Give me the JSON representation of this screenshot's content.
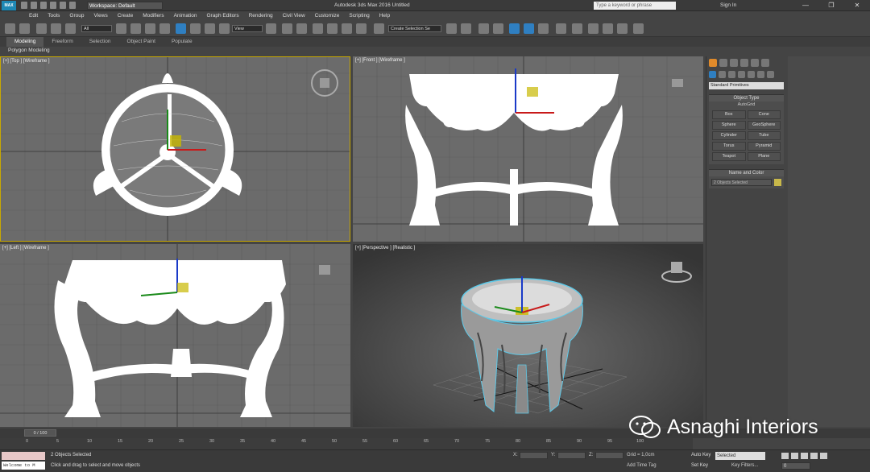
{
  "app": {
    "title": "Autodesk 3ds Max 2016     Untitled",
    "logo": "MAX",
    "workspace": "Workspace: Default",
    "search_placeholder": "Type a keyword or phrase",
    "signin": "Sign In"
  },
  "menu": [
    "Edit",
    "Tools",
    "Group",
    "Views",
    "Create",
    "Modifiers",
    "Animation",
    "Graph Editors",
    "Rendering",
    "Civil View",
    "Customize",
    "Scripting",
    "Help"
  ],
  "toolbar": {
    "filter": "All",
    "ref_coord": "View",
    "selection_set": "Create Selection Se"
  },
  "ribbon": {
    "tabs": [
      "Modeling",
      "Freeform",
      "Selection",
      "Object Paint",
      "Populate"
    ],
    "active_tab": "Modeling",
    "sub": "Polygon Modeling"
  },
  "viewports": {
    "top": "[+] [Top ] [Wireframe ]",
    "front": "[+] [Front ] [Wireframe ]",
    "left": "[+] [Left ] [Wireframe ]",
    "perspective": "[+] [Perspective ] [Realistic ]"
  },
  "command_panel": {
    "dropdown": "Standard Primitives",
    "object_type_title": "Object Type",
    "autogrid": "AutoGrid",
    "buttons": [
      "Box",
      "Cone",
      "Sphere",
      "GeoSphere",
      "Cylinder",
      "Tube",
      "Torus",
      "Pyramid",
      "Teapot",
      "Plane"
    ],
    "name_color_title": "Name and Color",
    "name_value": "2 Objects Selected",
    "swatch_color": "#c8b84a"
  },
  "timeline": {
    "slider": "0 / 100",
    "ticks": [
      "0",
      "5",
      "10",
      "15",
      "20",
      "25",
      "30",
      "35",
      "40",
      "45",
      "50",
      "55",
      "60",
      "65",
      "70",
      "75",
      "80",
      "85",
      "90",
      "95",
      "100"
    ]
  },
  "status": {
    "maxscript": "Welcome to M",
    "selected": "2 Objects Selected",
    "prompt": "Click and drag to select and move objects",
    "x_label": "X:",
    "y_label": "Y:",
    "z_label": "Z:",
    "grid": "Grid = 1,0cm",
    "add_time_tag": "Add Time Tag",
    "auto_key": "Auto Key",
    "set_key": "Set Key",
    "selected_dropdown": "Selected",
    "key_filters": "Key Filters...",
    "frame": "0"
  },
  "watermark": "Asnaghi Interiors"
}
